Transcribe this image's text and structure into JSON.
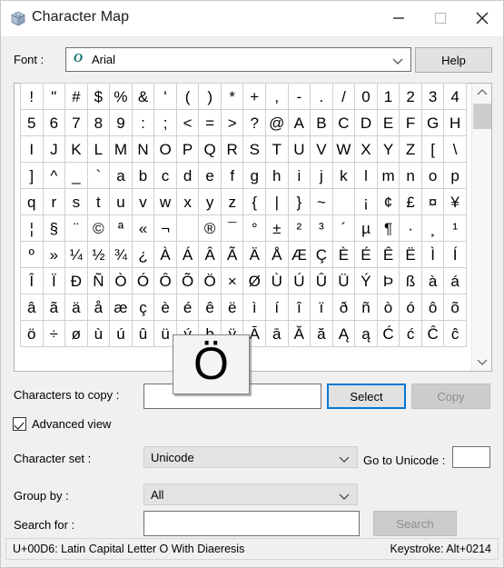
{
  "window": {
    "title": "Character Map",
    "icon": "character-map-icon",
    "controls": {
      "minimize": "minimize-icon",
      "maximize": "maximize-icon",
      "close": "close-icon"
    }
  },
  "font": {
    "label": "Font :",
    "value": "Arial",
    "type_icon": "O",
    "chevron": "chevron-down-icon",
    "help_label": "Help"
  },
  "grid": {
    "columns": 20,
    "rows": [
      [
        "!",
        "\"",
        "#",
        "$",
        "%",
        "&",
        "'",
        "(",
        ")",
        "*",
        "+",
        ",",
        "-",
        ".",
        "/",
        "0",
        "1",
        "2",
        "3",
        "4"
      ],
      [
        "5",
        "6",
        "7",
        "8",
        "9",
        ":",
        ";",
        "<",
        "=",
        ">",
        "?",
        "@",
        "A",
        "B",
        "C",
        "D",
        "E",
        "F",
        "G",
        "H"
      ],
      [
        "I",
        "J",
        "K",
        "L",
        "M",
        "N",
        "O",
        "P",
        "Q",
        "R",
        "S",
        "T",
        "U",
        "V",
        "W",
        "X",
        "Y",
        "Z",
        "[",
        "\\"
      ],
      [
        "]",
        "^",
        "_",
        "`",
        "a",
        "b",
        "c",
        "d",
        "e",
        "f",
        "g",
        "h",
        "i",
        "j",
        "k",
        "l",
        "m",
        "n",
        "o",
        "p"
      ],
      [
        "q",
        "r",
        "s",
        "t",
        "u",
        "v",
        "w",
        "x",
        "y",
        "z",
        "{",
        "|",
        "}",
        "~",
        " ",
        "¡",
        "¢",
        "£",
        "¤",
        "¥"
      ],
      [
        "¦",
        "§",
        "¨",
        "©",
        "ª",
        "«",
        "¬",
        "­",
        "®",
        "¯",
        "°",
        "±",
        "²",
        "³",
        "´",
        "µ",
        "¶",
        "·",
        "¸",
        "¹"
      ],
      [
        "º",
        "»",
        "¼",
        "½",
        "¾",
        "¿",
        "À",
        "Á",
        "Â",
        "Ã",
        "Ä",
        "Å",
        "Æ",
        "Ç",
        "È",
        "É",
        "Ê",
        "Ë",
        "Ì",
        "Í"
      ],
      [
        "Î",
        "Ï",
        "Ð",
        "Ñ",
        "Ò",
        "Ó",
        "Ô",
        "Õ",
        "Ö",
        "×",
        "Ø",
        "Ù",
        "Ú",
        "Û",
        "Ü",
        "Ý",
        "Þ",
        "ß",
        "à",
        "á"
      ],
      [
        "â",
        "ã",
        "ä",
        "å",
        "æ",
        "ç",
        "è",
        "é",
        "ê",
        "ë",
        "ì",
        "í",
        "î",
        "ï",
        "ð",
        "ñ",
        "ò",
        "ó",
        "ô",
        "õ"
      ],
      [
        "ö",
        "÷",
        "ø",
        "ù",
        "ú",
        "û",
        "ü",
        "ý",
        "þ",
        "ÿ",
        "Ā",
        "ā",
        "Ă",
        "ă",
        "Ą",
        "ą",
        "Ć",
        "ć",
        "Ĉ",
        "ĉ"
      ]
    ],
    "magnified_char": "Ö",
    "scrollbar": {
      "up": "chevron-up-icon",
      "down": "chevron-down-icon"
    }
  },
  "copy_row": {
    "label": "Characters to copy :",
    "value": "",
    "select_label": "Select",
    "copy_label": "Copy"
  },
  "advanced_view": {
    "label": "Advanced view",
    "checked": true
  },
  "character_set": {
    "label": "Character set :",
    "value": "Unicode",
    "chevron": "chevron-down-icon"
  },
  "go_to_unicode": {
    "label": "Go to Unicode :",
    "value": ""
  },
  "group_by": {
    "label": "Group by :",
    "value": "All",
    "chevron": "chevron-down-icon"
  },
  "search": {
    "label": "Search for :",
    "value": "",
    "button_label": "Search"
  },
  "status": {
    "left": "U+00D6: Latin Capital Letter O With Diaeresis",
    "right": "Keystroke: Alt+0214"
  }
}
